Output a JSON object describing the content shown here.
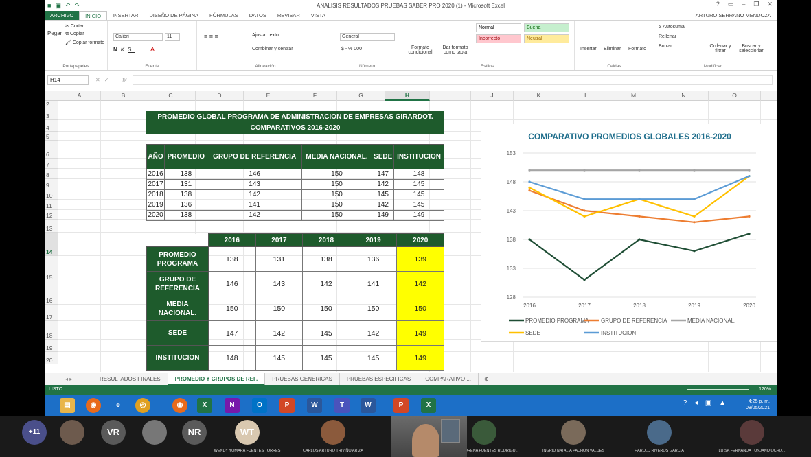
{
  "window": {
    "title": "ANALISIS RESULTADOS PRUEBAS SABER PRO 2020 (1) - Microsoft Excel",
    "user": "ARTURO SERRANO MENDOZA"
  },
  "menu": [
    "ARCHIVO",
    "INICIO",
    "INSERTAR",
    "DISEÑO DE PÁGINA",
    "FÓRMULAS",
    "DATOS",
    "REVISAR",
    "VISTA"
  ],
  "ribbon": {
    "clipboard": {
      "cut": "Cortar",
      "copy": "Copiar",
      "paste": "Pegar",
      "format_painter": "Copiar formato",
      "name": "Portapapeles"
    },
    "font": {
      "family": "Calibri",
      "size": "11",
      "name": "Fuente"
    },
    "alignment": {
      "wrap": "Ajustar texto",
      "merge": "Combinar y centrar",
      "name": "Alineación"
    },
    "number": {
      "format": "General",
      "name": "Número"
    },
    "styles": {
      "conditional": "Formato condicional",
      "as_table": "Dar formato como tabla",
      "cells": [
        {
          "label": "Normal",
          "bg": "#ffffff",
          "fg": "#000000"
        },
        {
          "label": "Buena",
          "bg": "#c6efce",
          "fg": "#006100"
        },
        {
          "label": "Incorrecto",
          "bg": "#ffc7ce",
          "fg": "#9c0006"
        },
        {
          "label": "Neutral",
          "bg": "#ffeb9c",
          "fg": "#9c6500"
        }
      ],
      "name": "Estilos"
    },
    "cells": {
      "insert": "Insertar",
      "delete": "Eliminar",
      "format": "Formato",
      "name": "Celdas"
    },
    "editing": {
      "autosum": "Autosuma",
      "fill": "Rellenar",
      "clear": "Borrar",
      "sort": "Ordenar y filtrar",
      "find": "Buscar y seleccionar",
      "name": "Modificar"
    }
  },
  "formula_bar": {
    "name_box": "H14",
    "fx": "fx"
  },
  "columns": [
    "A",
    "B",
    "C",
    "D",
    "E",
    "F",
    "G",
    "H",
    "I",
    "J",
    "K",
    "L",
    "M",
    "N",
    "O"
  ],
  "selected_column": "H",
  "rows": [
    "2",
    "3",
    "4",
    "5",
    "6",
    "7",
    "8",
    "9",
    "10",
    "11",
    "12",
    "13",
    "14",
    "15",
    "16",
    "17",
    "18",
    "19",
    "20"
  ],
  "selected_row": "14",
  "table1": {
    "title_line1": "PROMEDIO GLOBAL PROGRAMA DE ADMINISTRACION DE EMPRESAS GIRARDOT.",
    "title_line2": "COMPARATIVOS  2016-2020",
    "headers": [
      "AÑO",
      "PROMEDIO",
      "GRUPO DE REFERENCIA",
      "MEDIA NACIONAL.",
      "SEDE",
      "INSTITUCION"
    ],
    "rows": [
      [
        "2016",
        "138",
        "146",
        "150",
        "147",
        "148"
      ],
      [
        "2017",
        "131",
        "143",
        "150",
        "142",
        "145"
      ],
      [
        "2018",
        "138",
        "142",
        "150",
        "145",
        "145"
      ],
      [
        "2019",
        "136",
        "141",
        "150",
        "142",
        "145"
      ],
      [
        "2020",
        "138",
        "142",
        "150",
        "149",
        "149"
      ]
    ]
  },
  "table2": {
    "headers": [
      "2016",
      "2017",
      "2018",
      "2019",
      "2020"
    ],
    "rows": [
      {
        "label": "PROMEDIO PROGRAMA",
        "values": [
          "138",
          "131",
          "138",
          "136",
          "139"
        ]
      },
      {
        "label": "GRUPO DE REFERENCIA",
        "values": [
          "146",
          "143",
          "142",
          "141",
          "142"
        ]
      },
      {
        "label": "MEDIA NACIONAL.",
        "values": [
          "150",
          "150",
          "150",
          "150",
          "150"
        ]
      },
      {
        "label": "SEDE",
        "values": [
          "147",
          "142",
          "145",
          "142",
          "149"
        ]
      },
      {
        "label": "INSTITUCION",
        "values": [
          "148",
          "145",
          "145",
          "145",
          "149"
        ]
      }
    ]
  },
  "chart_data": {
    "type": "line",
    "title": "COMPARATIVO PROMEDIOS GLOBALES 2016-2020",
    "categories": [
      "2016",
      "2017",
      "2018",
      "2019",
      "2020"
    ],
    "ylim": [
      128,
      153
    ],
    "yticks": [
      128,
      133,
      138,
      143,
      148,
      153
    ],
    "grid": true,
    "legend": "bottom",
    "series": [
      {
        "name": "PROMEDIO PROGRAMA",
        "color": "#1e4d34",
        "values": [
          138,
          131,
          138,
          136,
          139
        ]
      },
      {
        "name": "GRUPO DE REFERENCIA",
        "color": "#ed7d31",
        "values": [
          146.5,
          143,
          142,
          141,
          142
        ]
      },
      {
        "name": "MEDIA NACIONAL.",
        "color": "#a5a5a5",
        "values": [
          150,
          150,
          150,
          150,
          150
        ]
      },
      {
        "name": "SEDE",
        "color": "#ffc000",
        "values": [
          147,
          142,
          145,
          142,
          149
        ]
      },
      {
        "name": "INSTITUCION",
        "color": "#5b9bd5",
        "values": [
          148,
          145,
          145,
          145,
          149
        ]
      }
    ]
  },
  "sheet_tabs": [
    "RESULTADOS FINALES",
    "PROMEDIO Y GRUPOS DE REF.",
    "PRUEBAS GENERICAS",
    "PRUEBAS ESPECIFICAS",
    "COMPARATIVO ..."
  ],
  "active_sheet": "PROMEDIO Y GRUPOS DE REF.",
  "status": {
    "mode": "LISTO",
    "zoom": "120%"
  },
  "taskbar": {
    "time": "4:25 p. m.",
    "date": "08/05/2021"
  },
  "meeting": {
    "more": "+11",
    "participants": [
      {
        "initials": "",
        "name": "",
        "color": "#6d5a4d"
      },
      {
        "initials": "VR",
        "name": "",
        "color": "#5a5a5a"
      },
      {
        "initials": "",
        "name": "",
        "color": "#777777"
      },
      {
        "initials": "NR",
        "name": "",
        "color": "#5a5a5a"
      },
      {
        "initials": "WT",
        "name": "WENDY YOMARA FUENTES TORRES",
        "color": "#d9c8b0"
      },
      {
        "initials": "",
        "name": "CARLOS ARTURO TRIVIÑO ARIZA",
        "color": "#8b5a3c"
      },
      {
        "initials": "",
        "name": "ANGIE LORENA FUENTES RODRIGU...",
        "color": "#3a5a3a"
      },
      {
        "initials": "",
        "name": "INGRID NATALIA PACHON VALDES",
        "color": "#7a6a5a"
      },
      {
        "initials": "",
        "name": "HAROLD RIVEROS GARCIA",
        "color": "#4a6a8a"
      },
      {
        "initials": "",
        "name": "LUISA FERNANDA TUNJANO OCHO...",
        "color": "#5a3a3a"
      }
    ]
  }
}
